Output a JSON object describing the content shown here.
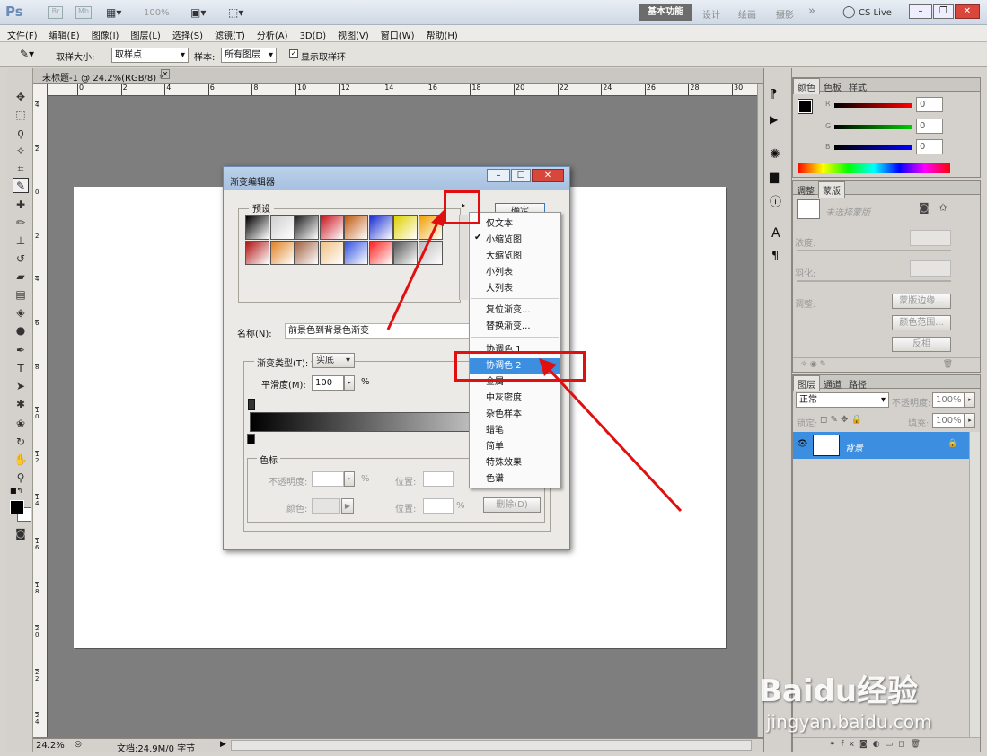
{
  "app": {
    "logo": "Ps",
    "mini_bridge_1": "Br",
    "mini_bridge_2": "Mb",
    "zoom_display": "100%",
    "workspaces": [
      "基本功能",
      "设计",
      "绘画",
      "摄影"
    ],
    "more": "»",
    "cs_live": "CS Live"
  },
  "menu": [
    "文件(F)",
    "编辑(E)",
    "图像(I)",
    "图层(L)",
    "选择(S)",
    "滤镜(T)",
    "分析(A)",
    "3D(D)",
    "视图(V)",
    "窗口(W)",
    "帮助(H)"
  ],
  "options": {
    "sample_size_label": "取样大小:",
    "sample_size_value": "取样点",
    "sample_label": "样本:",
    "sample_value": "所有图层",
    "show_ring_label": "显示取样环"
  },
  "document": {
    "tab_title": "未标题-1 @ 24.2%(RGB/8) *",
    "ruler_h": [
      "0",
      "2",
      "4",
      "6",
      "8",
      "10",
      "12",
      "14",
      "16",
      "18",
      "20",
      "22",
      "24",
      "26",
      "28",
      "30"
    ],
    "ruler_v": [
      "4",
      "2",
      "0",
      "2",
      "4",
      "6",
      "8",
      "1\n0",
      "1\n2",
      "1\n4",
      "1\n6",
      "1\n8",
      "2\n0",
      "2\n2",
      "2\n4"
    ],
    "zoom": "24.2%",
    "doc_info": "文档:24.9M/0 字节"
  },
  "dialog": {
    "title": "渐变编辑器",
    "preset_label": "预设",
    "ok_button": "确定",
    "name_label": "名称(N):",
    "name_value": "前景色到背景色渐变",
    "gradient_type_label": "渐变类型(T):",
    "gradient_type_value": "实底",
    "smoothness_label": "平滑度(M):",
    "smoothness_value": "100",
    "percent": "%",
    "stops_label": "色标",
    "opacity_label": "不透明度:",
    "location_label": "位置:",
    "color_label": "颜色:",
    "delete_button": "删除(D)",
    "swatch_colors": [
      "#000000",
      "#cfcfcf",
      "#222222",
      "#c8141e",
      "#c05a10",
      "#1a2fd0",
      "#e0d000",
      "#f0a000",
      "#b01010",
      "#e08020",
      "#a06040",
      "#f0c080",
      "#3050e0",
      "#ff2020",
      "#555555",
      "#bbbbbb"
    ]
  },
  "preset_menu": {
    "items": [
      "仅文本",
      "小缩览图",
      "大缩览图",
      "小列表",
      "大列表",
      "复位渐变...",
      "替换渐变...",
      "协调色 1",
      "协调色 2",
      "金属",
      "中灰密度",
      "杂色样本",
      "蜡笔",
      "简单",
      "特殊效果",
      "色谱"
    ],
    "checked": "小缩览图",
    "highlighted": "协调色 2"
  },
  "color_panel": {
    "tabs": [
      "颜色",
      "色板",
      "样式"
    ],
    "r_label": "R",
    "g_label": "G",
    "b_label": "B",
    "r": "0",
    "g": "0",
    "b": "0"
  },
  "adjust_panel": {
    "tabs": [
      "调整",
      "蒙版"
    ],
    "no_mask": "未选择蒙版",
    "density": "浓度:",
    "feather": "羽化:",
    "refine": "调整:",
    "mask_edge": "蒙版边缘...",
    "color_range": "颜色范围...",
    "invert": "反相"
  },
  "layers_panel": {
    "tabs": [
      "图层",
      "通道",
      "路径"
    ],
    "blend_mode": "正常",
    "opacity_label": "不透明度:",
    "opacity": "100%",
    "lock_label": "锁定:",
    "fill_label": "填充:",
    "fill": "100%",
    "layer_name": "背景"
  },
  "watermark": {
    "brand": "Baidu经验",
    "url": "jingyan.baidu.com"
  }
}
